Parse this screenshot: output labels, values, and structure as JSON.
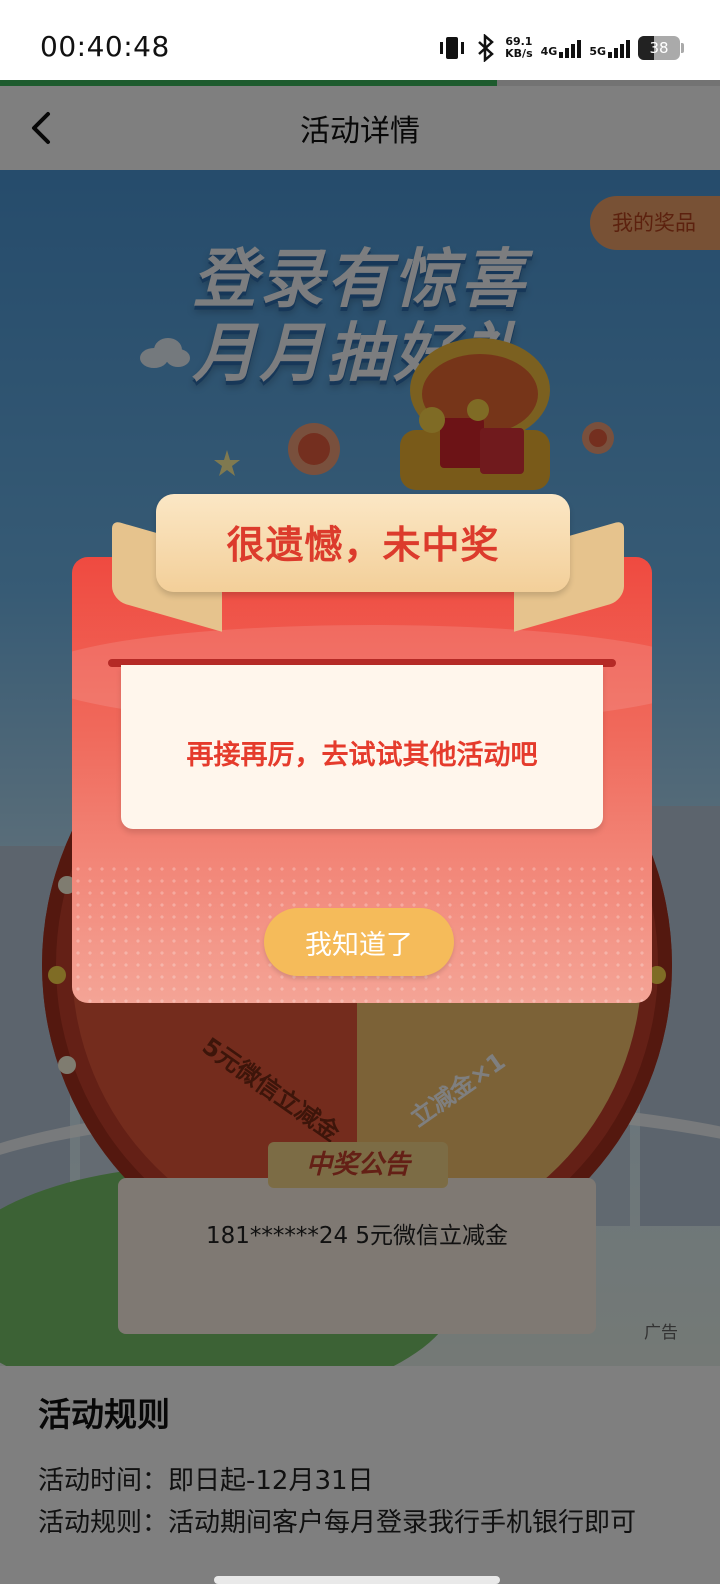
{
  "status_bar": {
    "time": "00:40:48",
    "net_speed_value": "69.1",
    "net_speed_unit": "KB/s",
    "signal_1": "4G",
    "signal_2": "5G",
    "battery": "38",
    "battery_level_percent": 38
  },
  "page_load_progress_percent": 69,
  "nav": {
    "title": "活动详情",
    "back_icon": "chevron-left-icon"
  },
  "hero": {
    "title_line1": "登录有惊喜",
    "title_line2": "月月抽好礼",
    "my_prizes_button": "我的奖品",
    "wheel_prize_1": "5元微信立减金",
    "wheel_prize_2": "立减金×1",
    "announcement_title": "中奖公告",
    "announcement_item": "181******24 5元微信立减金",
    "ad_label": "广告"
  },
  "rules": {
    "title": "活动规则",
    "line1": "活动时间：即日起-12月31日",
    "line2": "活动规则：活动期间客户每月登录我行手机银行即可"
  },
  "dialog": {
    "title": "很遗憾，未中奖",
    "message": "再接再厉，去试试其他活动吧",
    "ok_button": "我知道了"
  },
  "colors": {
    "dialog_red": "#ef4a40",
    "ribbon_gold": "#f3cf99",
    "button_gold": "#f5bb5a",
    "progress_green": "#3db65c"
  }
}
